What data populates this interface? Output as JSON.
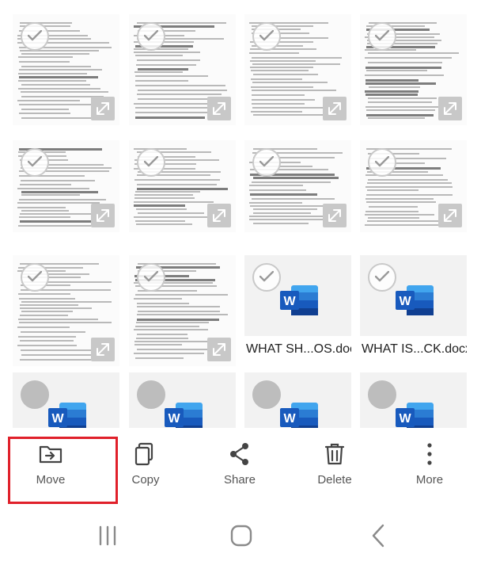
{
  "files": [
    {
      "kind": "doc",
      "name": ""
    },
    {
      "kind": "doc",
      "name": ""
    },
    {
      "kind": "doc",
      "name": ""
    },
    {
      "kind": "doc",
      "name": ""
    },
    {
      "kind": "doc",
      "name": ""
    },
    {
      "kind": "doc",
      "name": ""
    },
    {
      "kind": "doc",
      "name": ""
    },
    {
      "kind": "doc",
      "name": ""
    },
    {
      "kind": "doc",
      "name": ""
    },
    {
      "kind": "doc",
      "name": ""
    },
    {
      "kind": "word",
      "name": "WHAT SH...OS.docx"
    },
    {
      "kind": "word",
      "name": "WHAT IS...CK.docx"
    },
    {
      "kind": "word",
      "name": ""
    },
    {
      "kind": "word",
      "name": ""
    },
    {
      "kind": "word",
      "name": ""
    },
    {
      "kind": "word",
      "name": ""
    }
  ],
  "actions": {
    "move": {
      "label": "Move",
      "icon": "folder-move-icon"
    },
    "copy": {
      "label": "Copy",
      "icon": "copy-icon"
    },
    "share": {
      "label": "Share",
      "icon": "share-icon"
    },
    "delete": {
      "label": "Delete",
      "icon": "trash-icon"
    },
    "more": {
      "label": "More",
      "icon": "more-vertical-icon"
    }
  },
  "highlight": {
    "target": "move",
    "color": "#e0202a"
  },
  "colors": {
    "word_blue": "#185abd",
    "word_dark": "#103f91",
    "icon_grey": "#555555"
  }
}
